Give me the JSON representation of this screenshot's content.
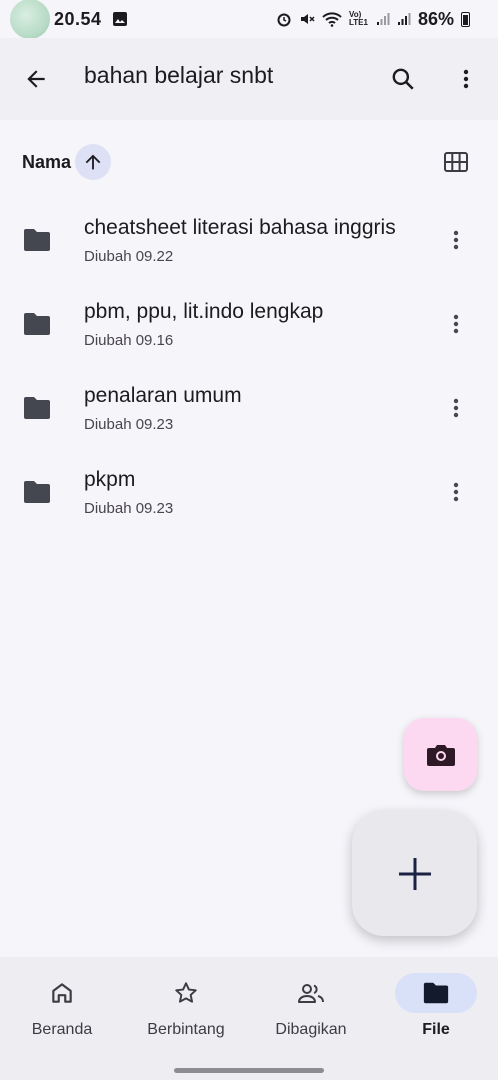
{
  "status_bar": {
    "time": "20.54",
    "battery": "86%",
    "network": "Vo) LTE1"
  },
  "app_bar": {
    "title": "bahan belajar snbt"
  },
  "sort": {
    "label": "Nama",
    "direction": "ascending"
  },
  "files": [
    {
      "name": "cheatsheet literasi bahasa inggris",
      "modified": "Diubah 09.22"
    },
    {
      "name": "pbm, ppu, lit.indo lengkap",
      "modified": "Diubah 09.16"
    },
    {
      "name": "penalaran umum",
      "modified": "Diubah 09.23"
    },
    {
      "name": "pkpm",
      "modified": "Diubah 09.23"
    }
  ],
  "bottom_nav": {
    "items": [
      {
        "label": "Beranda",
        "icon": "home-icon"
      },
      {
        "label": "Berbintang",
        "icon": "star-icon"
      },
      {
        "label": "Dibagikan",
        "icon": "people-icon"
      },
      {
        "label": "File",
        "icon": "folder-icon",
        "active": true
      }
    ]
  },
  "colors": {
    "background": "#f6f5fa",
    "camera_fab": "#fcd8f1",
    "active_nav": "#d9e1f8",
    "sort_chip": "#dee0f5"
  }
}
